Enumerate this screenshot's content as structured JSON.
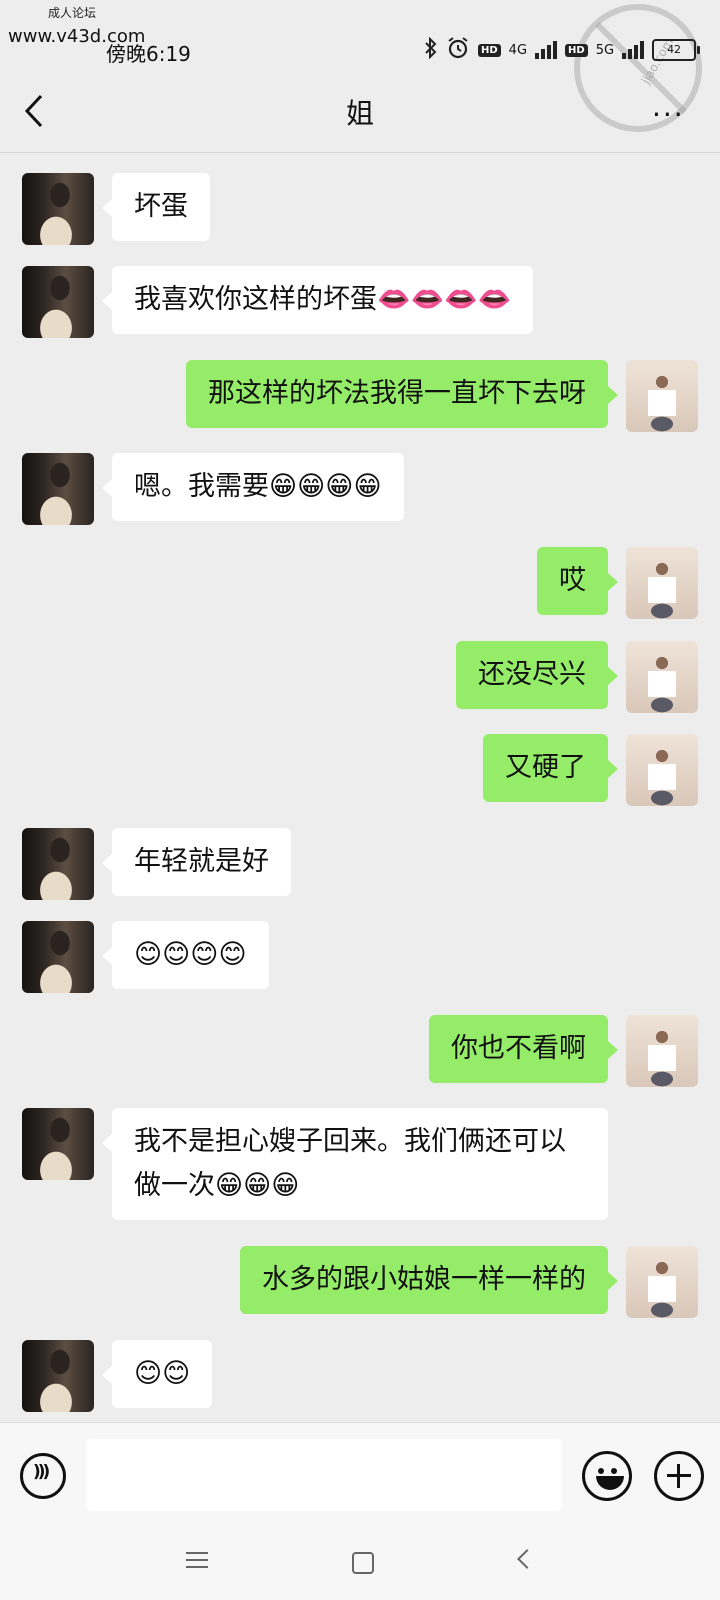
{
  "watermark": {
    "top_text": "成人论坛",
    "url": "www.v43d.com",
    "stamp_text": "jiao.com"
  },
  "status_bar": {
    "time": "傍晚6:19",
    "network_1": "4G",
    "network_2": "5G",
    "hd_label": "HD",
    "battery": "42"
  },
  "header": {
    "title": "姐",
    "more": "···"
  },
  "messages": [
    {
      "from": "her",
      "text": "坏蛋"
    },
    {
      "from": "her",
      "text": "我喜欢你这样的坏蛋👄👄👄👄"
    },
    {
      "from": "me",
      "text": "那这样的坏法我得一直坏下去呀"
    },
    {
      "from": "her",
      "text": "嗯。我需要😁😁😁😁"
    },
    {
      "from": "me",
      "text": "哎"
    },
    {
      "from": "me",
      "text": "还没尽兴"
    },
    {
      "from": "me",
      "text": "又硬了"
    },
    {
      "from": "her",
      "text": "年轻就是好"
    },
    {
      "from": "her",
      "text": "😊😊😊😊"
    },
    {
      "from": "me",
      "text": "你也不看啊"
    },
    {
      "from": "her",
      "text": "我不是担心嫂子回来。我们俩还可以做一次😁😁😁"
    },
    {
      "from": "me",
      "text": "水多的跟小姑娘一样一样的"
    },
    {
      "from": "her",
      "text": "😊😊"
    }
  ],
  "input_bar": {
    "placeholder": ""
  },
  "icons": {
    "voice": "voice-icon",
    "emoji": "emoji-icon",
    "plus": "plus-icon",
    "back": "back-arrow-icon",
    "more": "more-dots-icon"
  }
}
